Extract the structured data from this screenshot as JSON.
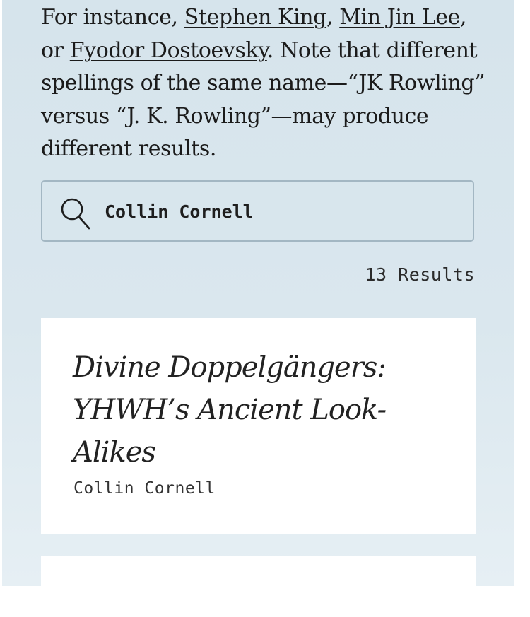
{
  "intro": {
    "prefix": "For instance, ",
    "link1": "Stephen King",
    "sep1": ", ",
    "link2": "Min Jin Lee",
    "sep2": ", or ",
    "link3": "Fyodor Dostoevsky",
    "suffix": ". Note that different spellings of the same name—“JK Rowling” versus “J. K. Rowling”—may produce different results."
  },
  "search": {
    "value": "Collin Cornell",
    "icon": "search-icon"
  },
  "results": {
    "count_label": "13 Results"
  },
  "cards": [
    {
      "title": "Divine Doppelgängers: YHWH’s Ancient Look-Alikes",
      "author": "Collin Cornell"
    }
  ]
}
